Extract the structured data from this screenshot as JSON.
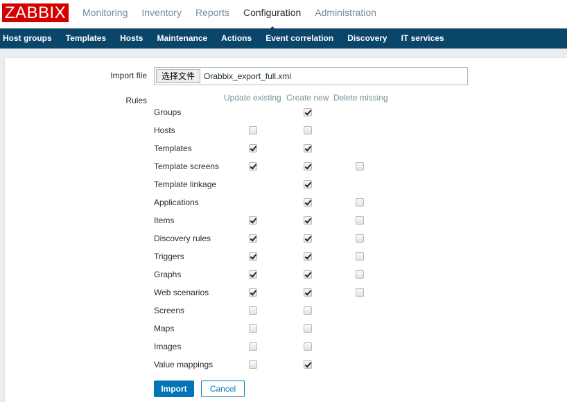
{
  "header": {
    "logo": "ZABBIX",
    "main_menu": [
      {
        "label": "Monitoring",
        "active": false
      },
      {
        "label": "Inventory",
        "active": false
      },
      {
        "label": "Reports",
        "active": false
      },
      {
        "label": "Configuration",
        "active": true
      },
      {
        "label": "Administration",
        "active": false
      }
    ],
    "sub_menu": [
      {
        "label": "Host groups"
      },
      {
        "label": "Templates"
      },
      {
        "label": "Hosts"
      },
      {
        "label": "Maintenance"
      },
      {
        "label": "Actions"
      },
      {
        "label": "Event correlation"
      },
      {
        "label": "Discovery"
      },
      {
        "label": "IT services"
      }
    ]
  },
  "form": {
    "import_file_label": "Import file",
    "file_button_label": "选择文件",
    "file_name": "Orabbix_export_full.xml",
    "rules_label": "Rules",
    "columns": [
      "Update existing",
      "Create new",
      "Delete missing"
    ],
    "rules": [
      {
        "name": "Groups",
        "update_existing": null,
        "create_new": true,
        "delete_missing": null
      },
      {
        "name": "Hosts",
        "update_existing": false,
        "create_new": false,
        "delete_missing": null
      },
      {
        "name": "Templates",
        "update_existing": true,
        "create_new": true,
        "delete_missing": null
      },
      {
        "name": "Template screens",
        "update_existing": true,
        "create_new": true,
        "delete_missing": false
      },
      {
        "name": "Template linkage",
        "update_existing": null,
        "create_new": true,
        "delete_missing": null
      },
      {
        "name": "Applications",
        "update_existing": null,
        "create_new": true,
        "delete_missing": false
      },
      {
        "name": "Items",
        "update_existing": true,
        "create_new": true,
        "delete_missing": false
      },
      {
        "name": "Discovery rules",
        "update_existing": true,
        "create_new": true,
        "delete_missing": false
      },
      {
        "name": "Triggers",
        "update_existing": true,
        "create_new": true,
        "delete_missing": false
      },
      {
        "name": "Graphs",
        "update_existing": true,
        "create_new": true,
        "delete_missing": false
      },
      {
        "name": "Web scenarios",
        "update_existing": true,
        "create_new": true,
        "delete_missing": false
      },
      {
        "name": "Screens",
        "update_existing": false,
        "create_new": false,
        "delete_missing": null
      },
      {
        "name": "Maps",
        "update_existing": false,
        "create_new": false,
        "delete_missing": null
      },
      {
        "name": "Images",
        "update_existing": false,
        "create_new": false,
        "delete_missing": null
      },
      {
        "name": "Value mappings",
        "update_existing": false,
        "create_new": true,
        "delete_missing": null
      }
    ],
    "import_button": "Import",
    "cancel_button": "Cancel"
  },
  "colors": {
    "logo_red": "#d40000",
    "nav_blue": "#0a466a",
    "button_blue": "#0275b8"
  }
}
